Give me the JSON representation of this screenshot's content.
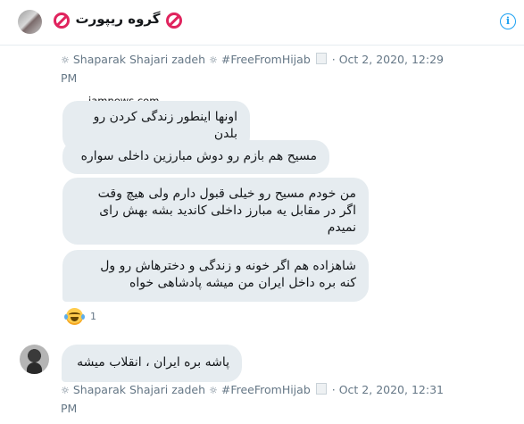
{
  "header": {
    "group_title": "گروه ریپورت",
    "info_icon": "info-icon",
    "emoji_icon": "no-entry-sign-icon"
  },
  "meta_top": {
    "user_name": "Shaparak Shajari zadeh",
    "hashtag": "#FreeFromHijab",
    "timestamp": "Oct 2, 2020, 12:29",
    "ampm": "PM",
    "separator": "·"
  },
  "watermark": "jamnews.com",
  "messages": [
    {
      "lines": [
        "اونها اینطور زندگی کردن رو بلدن"
      ]
    },
    {
      "lines": [
        "مسیح هم بازم رو دوش مبارزین داخلی سواره"
      ]
    },
    {
      "lines": [
        "من خودم مسیح رو خیلی قبول دارم ولی هیچ وقت",
        "اگر در مقابل یه مبارز داخلی کاندید بشه بهش رای",
        "نمیدم"
      ]
    },
    {
      "lines": [
        "شاهزاده هم اگر خونه و زندگی و دختر‌هاش رو ول",
        "کنه بره داخل ایران من میشه پادشاهی خواه"
      ]
    }
  ],
  "reaction": {
    "emoji": "face-with-tears-of-joy-icon",
    "count": "1"
  },
  "reply": {
    "lines": [
      "پاشه بره ایران ، انقلاب میشه"
    ]
  },
  "meta_bottom": {
    "user_name": "Shaparak Shajari zadeh",
    "hashtag": "#FreeFromHijab",
    "timestamp": "Oct 2, 2020, 12:31",
    "ampm": "PM",
    "separator": "·"
  },
  "colors": {
    "bubble": "#e6ecf0",
    "meta_text": "#657786",
    "accent": "#1da1f2",
    "ban_red": "#e0245e"
  }
}
